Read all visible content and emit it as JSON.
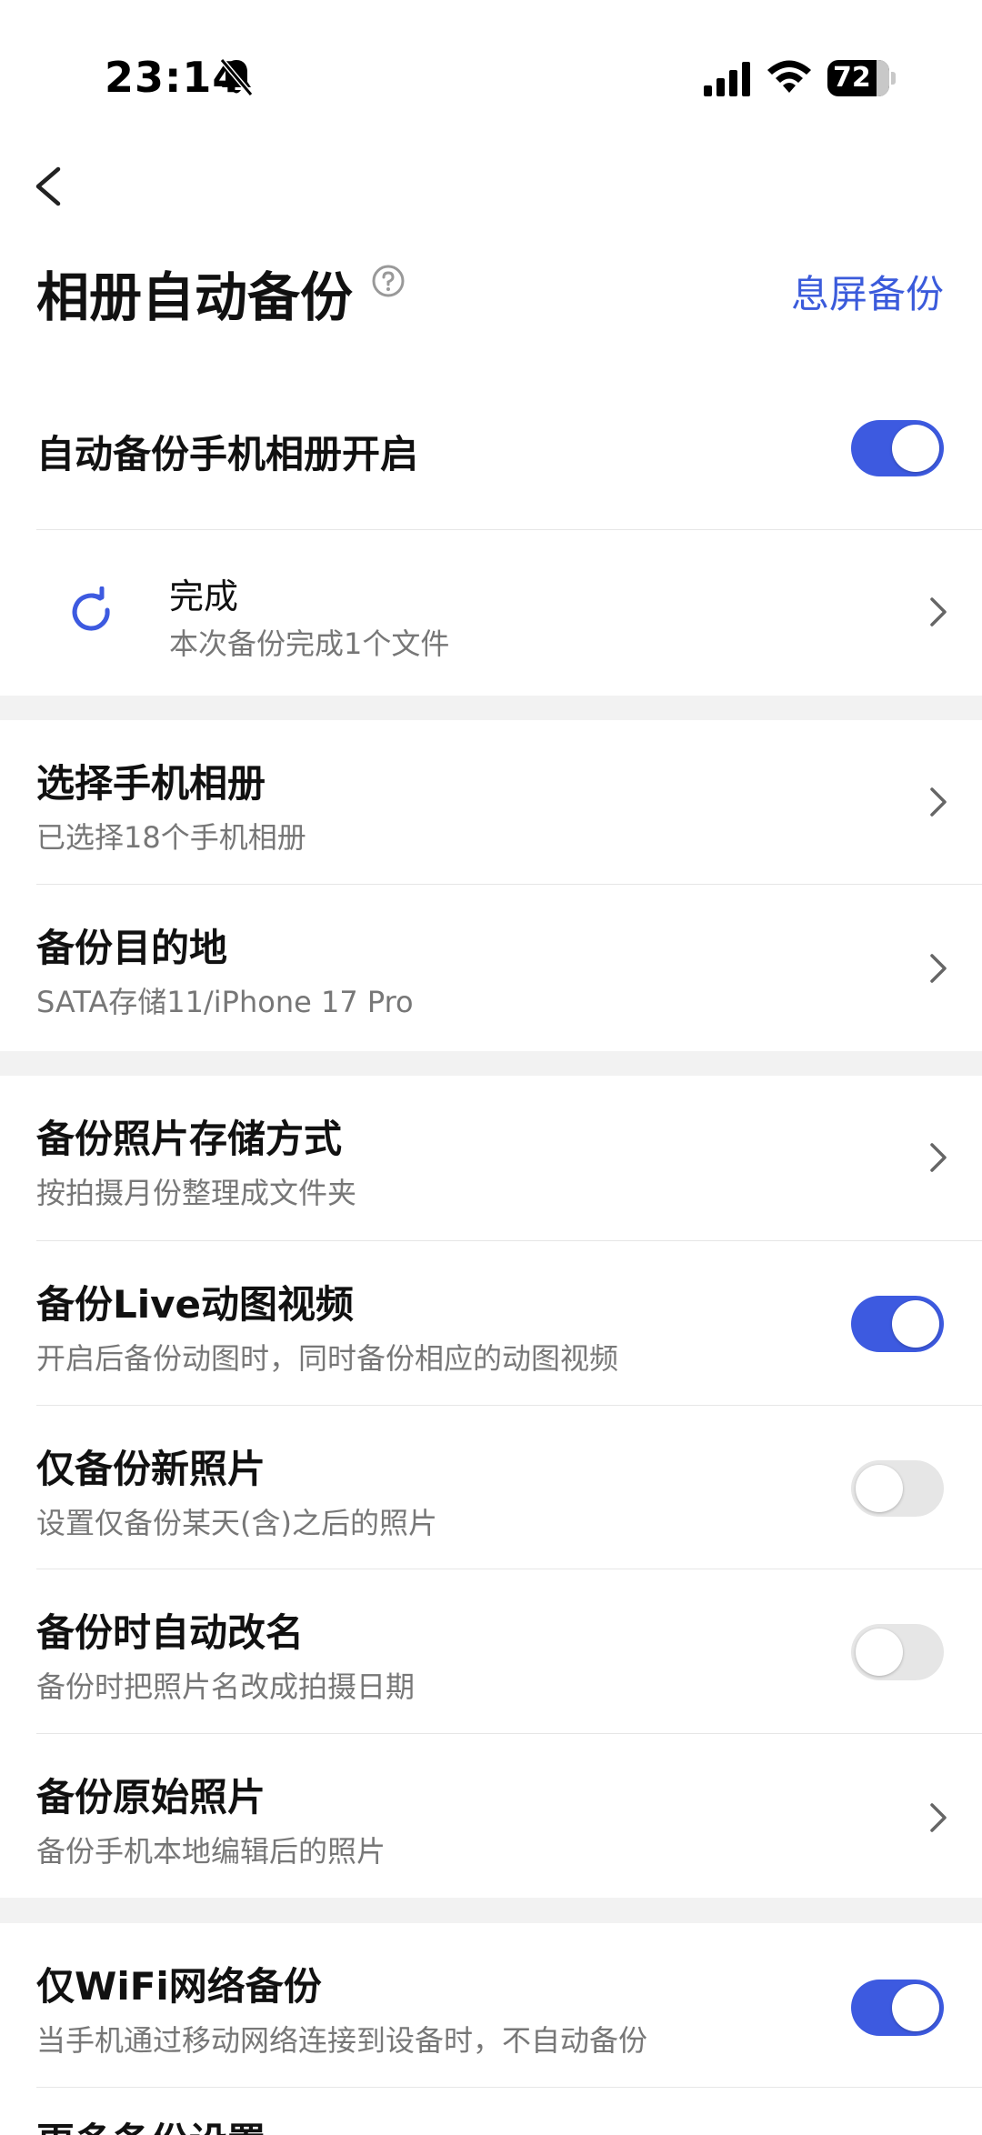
{
  "status_bar": {
    "time": "23:14",
    "battery": "72"
  },
  "header": {
    "title": "相册自动备份",
    "action_label": "息屏备份"
  },
  "auto_backup": {
    "label": "自动备份手机相册开启",
    "enabled": true
  },
  "backup_status": {
    "title": "完成",
    "subtitle": "本次备份完成1个文件"
  },
  "section1": [
    {
      "title": "选择手机相册",
      "subtitle": "已选择18个手机相册"
    },
    {
      "title": "备份目的地",
      "subtitle": "SATA存储11/iPhone 17 Pro"
    }
  ],
  "section2": [
    {
      "title": "备份照片存储方式",
      "subtitle": "按拍摄月份整理成文件夹",
      "control": "chevron"
    },
    {
      "title": "备份Live动图视频",
      "subtitle": "开启后备份动图时，同时备份相应的动图视频",
      "control": "toggle",
      "enabled": true
    },
    {
      "title": "仅备份新照片",
      "subtitle": "设置仅备份某天(含)之后的照片",
      "control": "toggle",
      "enabled": false
    },
    {
      "title": "备份时自动改名",
      "subtitle": "备份时把照片名改成拍摄日期",
      "control": "toggle",
      "enabled": false
    },
    {
      "title": "备份原始照片",
      "subtitle": "备份手机本地编辑后的照片",
      "control": "chevron"
    }
  ],
  "section3": [
    {
      "title": "仅WiFi网络备份",
      "subtitle": "当手机通过移动网络连接到设备时，不自动备份",
      "control": "toggle",
      "enabled": true
    },
    {
      "title": "更多备份设置"
    }
  ],
  "colors": {
    "accent": "#3d5ae0",
    "link": "#3b5bdb",
    "toggle_off": "#e6e6e6",
    "section_gap": "#f2f2f2"
  }
}
